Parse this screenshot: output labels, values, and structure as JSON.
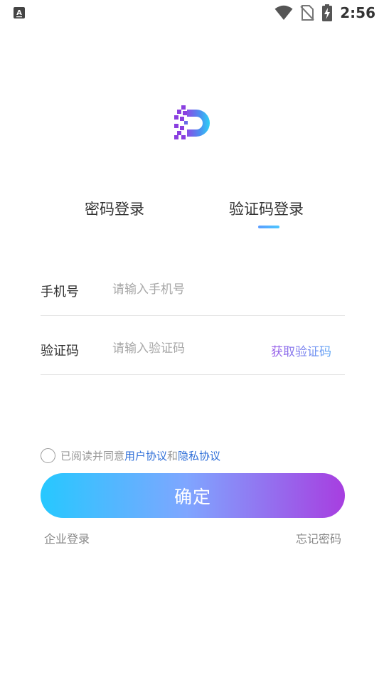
{
  "status_bar": {
    "time": "2:56",
    "icons": [
      "keyboard-a-icon",
      "wifi-icon",
      "no-sim-icon",
      "battery-charging-icon"
    ]
  },
  "logo": {
    "icon": "app-logo-d-icon"
  },
  "tabs": [
    {
      "label": "密码登录",
      "active": false
    },
    {
      "label": "验证码登录",
      "active": true
    }
  ],
  "form": {
    "phone": {
      "label": "手机号",
      "placeholder": "请输入手机号",
      "value": ""
    },
    "code": {
      "label": "验证码",
      "placeholder": "请输入验证码",
      "value": "",
      "get_code_label": "获取验证码"
    }
  },
  "agreement": {
    "checked": false,
    "prefix": "已阅读并同意",
    "user_agreement": "用户协议",
    "and": "和",
    "privacy_agreement": "隐私协议"
  },
  "confirm_label": "确定",
  "footer": {
    "enterprise_login": "企业登录",
    "forgot_password": "忘记密码"
  },
  "colors": {
    "accent_blue": "#26c8ff",
    "accent_purple": "#a73ee0",
    "link": "#2f6fd8"
  }
}
